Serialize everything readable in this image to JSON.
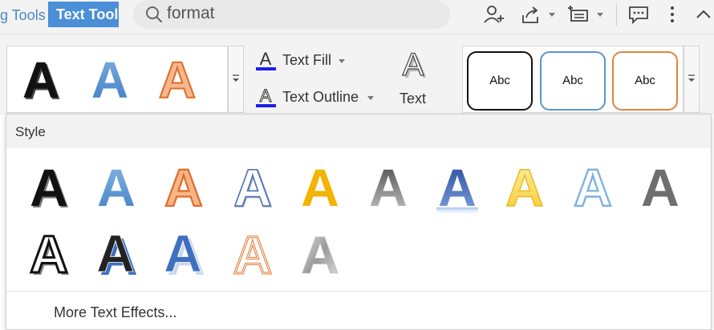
{
  "colors": {
    "tab_active_bg": "#4a8fd8",
    "tab_prev_text": "#4a86c8",
    "accent_blue": "#4a8fd8",
    "style_orange": "#e8803c",
    "style_yellow": "#f2b400"
  },
  "tabs": {
    "previous_label": "g Tools",
    "active_label": "Text Tool"
  },
  "search": {
    "value": "format",
    "icon": "search-icon"
  },
  "toolbar_icons": [
    "add-user-icon",
    "share-icon",
    "insert-comment-box-icon",
    "comment-icon",
    "more-icon",
    "collapse-chevron-icon"
  ],
  "ribbon": {
    "wordart_gallery_icons": [
      "black-bold-a",
      "blue-gradient-a",
      "orange-outline-a"
    ],
    "text_fill_label": "Text Fill",
    "text_outline_label": "Text Outline",
    "text_effects_label": "Text",
    "shape_styles": [
      "Abc",
      "Abc",
      "Abc"
    ]
  },
  "panel": {
    "title": "Style",
    "styles_row1": [
      "black-shadow",
      "blue-gradient",
      "orange-outline",
      "blue-outline",
      "gold-fill",
      "gray-gradient",
      "blue-reflection",
      "yellow-glow",
      "light-blue-outline",
      "gray-solid"
    ],
    "styles_row2": [
      "black-double-outline",
      "black-blue-offset",
      "blue-white-offset",
      "orange-double-outline",
      "silver-gradient"
    ],
    "more_label": "More Text Effects..."
  }
}
